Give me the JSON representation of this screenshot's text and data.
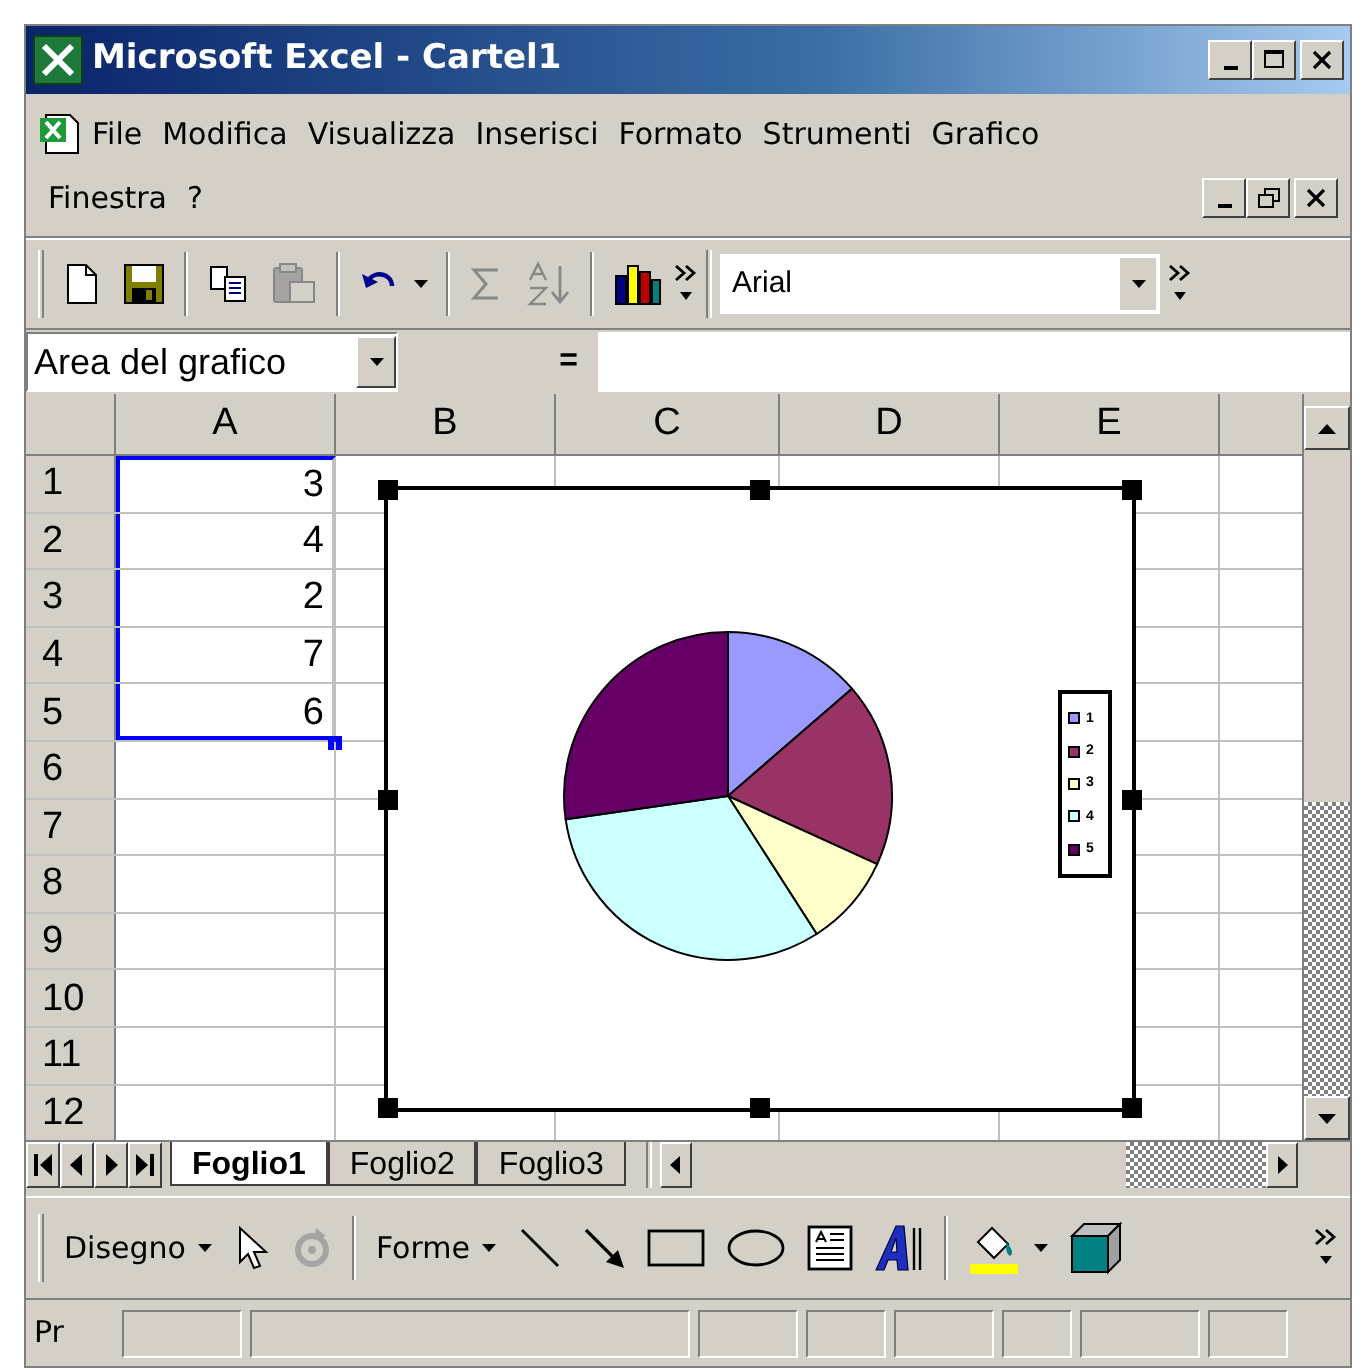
{
  "window": {
    "title": "Microsoft Excel - Cartel1"
  },
  "menu_bar": {
    "items": [
      {
        "label": "File"
      },
      {
        "label": "Modifica"
      },
      {
        "label": "Visualizza"
      },
      {
        "label": "Inserisci"
      },
      {
        "label": "Formato"
      },
      {
        "label": "Strumenti"
      },
      {
        "label": "Grafico"
      },
      {
        "label": "Finestra"
      },
      {
        "label": "?"
      }
    ]
  },
  "toolbar": {
    "groups": [
      [
        {
          "kind": "new",
          "disabled": false
        },
        {
          "kind": "save",
          "disabled": false
        }
      ],
      [
        {
          "kind": "copy",
          "disabled": false
        },
        {
          "kind": "paste",
          "disabled": true
        }
      ],
      [
        {
          "kind": "undo",
          "disabled": false
        }
      ],
      [
        {
          "kind": "autosum",
          "disabled": true
        },
        {
          "kind": "sort",
          "disabled": true
        }
      ],
      [
        {
          "kind": "chart",
          "disabled": false
        }
      ]
    ],
    "font": "Arial"
  },
  "formula_bar": {
    "name_box": "Area del grafico",
    "equals": "="
  },
  "sheet": {
    "columns": [
      "A",
      "B",
      "C",
      "D",
      "E"
    ],
    "rows": [
      {
        "header": "1",
        "col_a": "3",
        "selected": true
      },
      {
        "header": "2",
        "col_a": "4",
        "selected": true
      },
      {
        "header": "3",
        "col_a": "2",
        "selected": true
      },
      {
        "header": "4",
        "col_a": "7",
        "selected": true
      },
      {
        "header": "5",
        "col_a": "6",
        "selected": true
      },
      {
        "header": "6",
        "selected": false
      },
      {
        "header": "7",
        "selected": false
      },
      {
        "header": "8",
        "selected": false
      },
      {
        "header": "9",
        "selected": false
      },
      {
        "header": "10",
        "selected": false
      },
      {
        "header": "11",
        "selected": false
      },
      {
        "header": "12",
        "selected": false
      }
    ]
  },
  "chart": {
    "selected": true,
    "legend": [
      {
        "color": "#9999ff"
      },
      {
        "color": "#993366"
      },
      {
        "color": "#ffffcc"
      },
      {
        "color": "#ccffff"
      },
      {
        "color": "#660066"
      }
    ],
    "chart_data": {
      "type": "pie",
      "categories": [
        "1",
        "2",
        "3",
        "4",
        "5"
      ],
      "values": [
        13.64,
        18.18,
        9.09,
        31.82,
        27.27
      ]
    }
  },
  "sheet_tabs": [
    {
      "label": "Foglio1",
      "selected": true
    },
    {
      "label": "Foglio2",
      "selected": false
    },
    {
      "label": "Foglio3",
      "selected": false
    }
  ],
  "drawing_toolbar": {
    "groups": [
      [
        {
          "kind": "menu",
          "label": "Disegno",
          "disabled": false
        },
        {
          "kind": "select",
          "disabled": false
        },
        {
          "kind": "rotate",
          "disabled": true
        }
      ],
      [
        {
          "kind": "menu",
          "label": "Forme",
          "disabled": false
        },
        {
          "kind": "line",
          "disabled": false
        },
        {
          "kind": "arrow",
          "disabled": false
        },
        {
          "kind": "rectangle",
          "disabled": false
        },
        {
          "kind": "oval",
          "disabled": false
        },
        {
          "kind": "textbox",
          "disabled": false
        },
        {
          "kind": "wordart",
          "disabled": false
        }
      ],
      [
        {
          "kind": "fill",
          "disabled": false
        },
        {
          "kind": "cube",
          "disabled": false
        }
      ]
    ]
  },
  "status_bar": {
    "text": "Pr"
  }
}
